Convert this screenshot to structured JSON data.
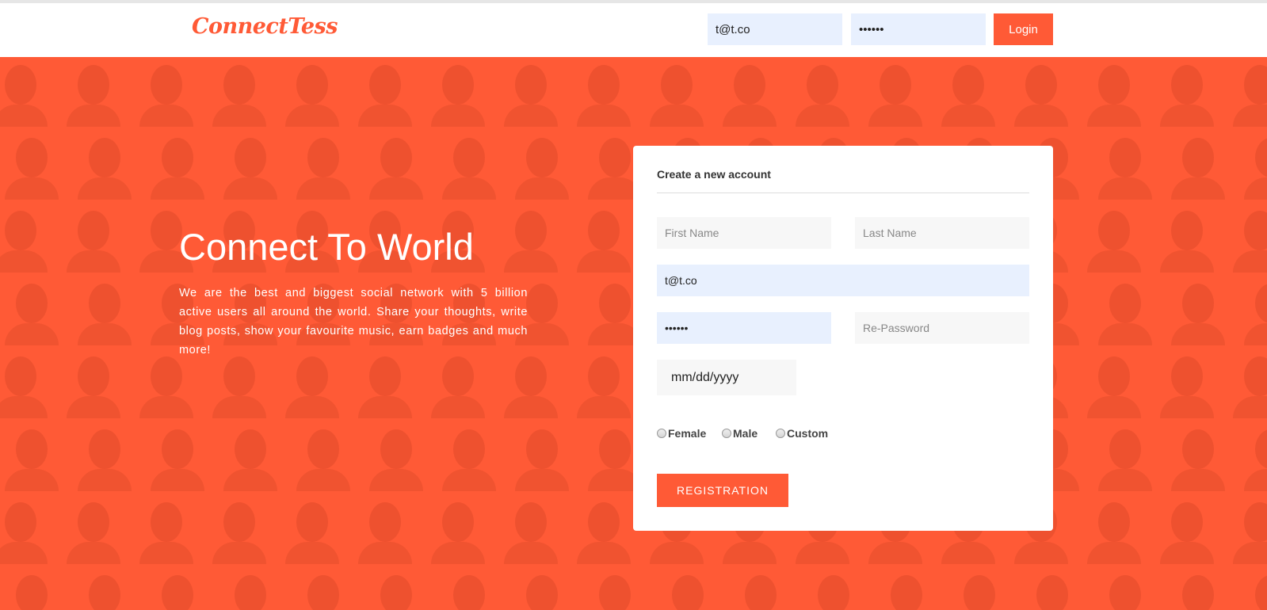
{
  "header": {
    "logo": "ConnectTess",
    "email_value": "t@t.co",
    "password_value": "••••••",
    "login_label": "Login"
  },
  "hero": {
    "title": "Connect To World",
    "description": "We are the best and biggest social network with 5 billion active users all around the world. Share your thoughts, write blog posts, show your favourite music, earn badges and much more!"
  },
  "register": {
    "title": "Create a new account",
    "first_name_placeholder": "First Name",
    "last_name_placeholder": "Last Name",
    "email_value": "t@t.co",
    "password_value": "••••••",
    "repassword_placeholder": "Re-Password",
    "date_placeholder": "mm/dd/yyyy",
    "gender_options": [
      "Female",
      "Male",
      "Custom"
    ],
    "submit_label": "REGISTRATION"
  },
  "colors": {
    "accent": "#ff5a36",
    "autofill": "#e8f0fe",
    "field_bg": "#f7f7f7"
  }
}
